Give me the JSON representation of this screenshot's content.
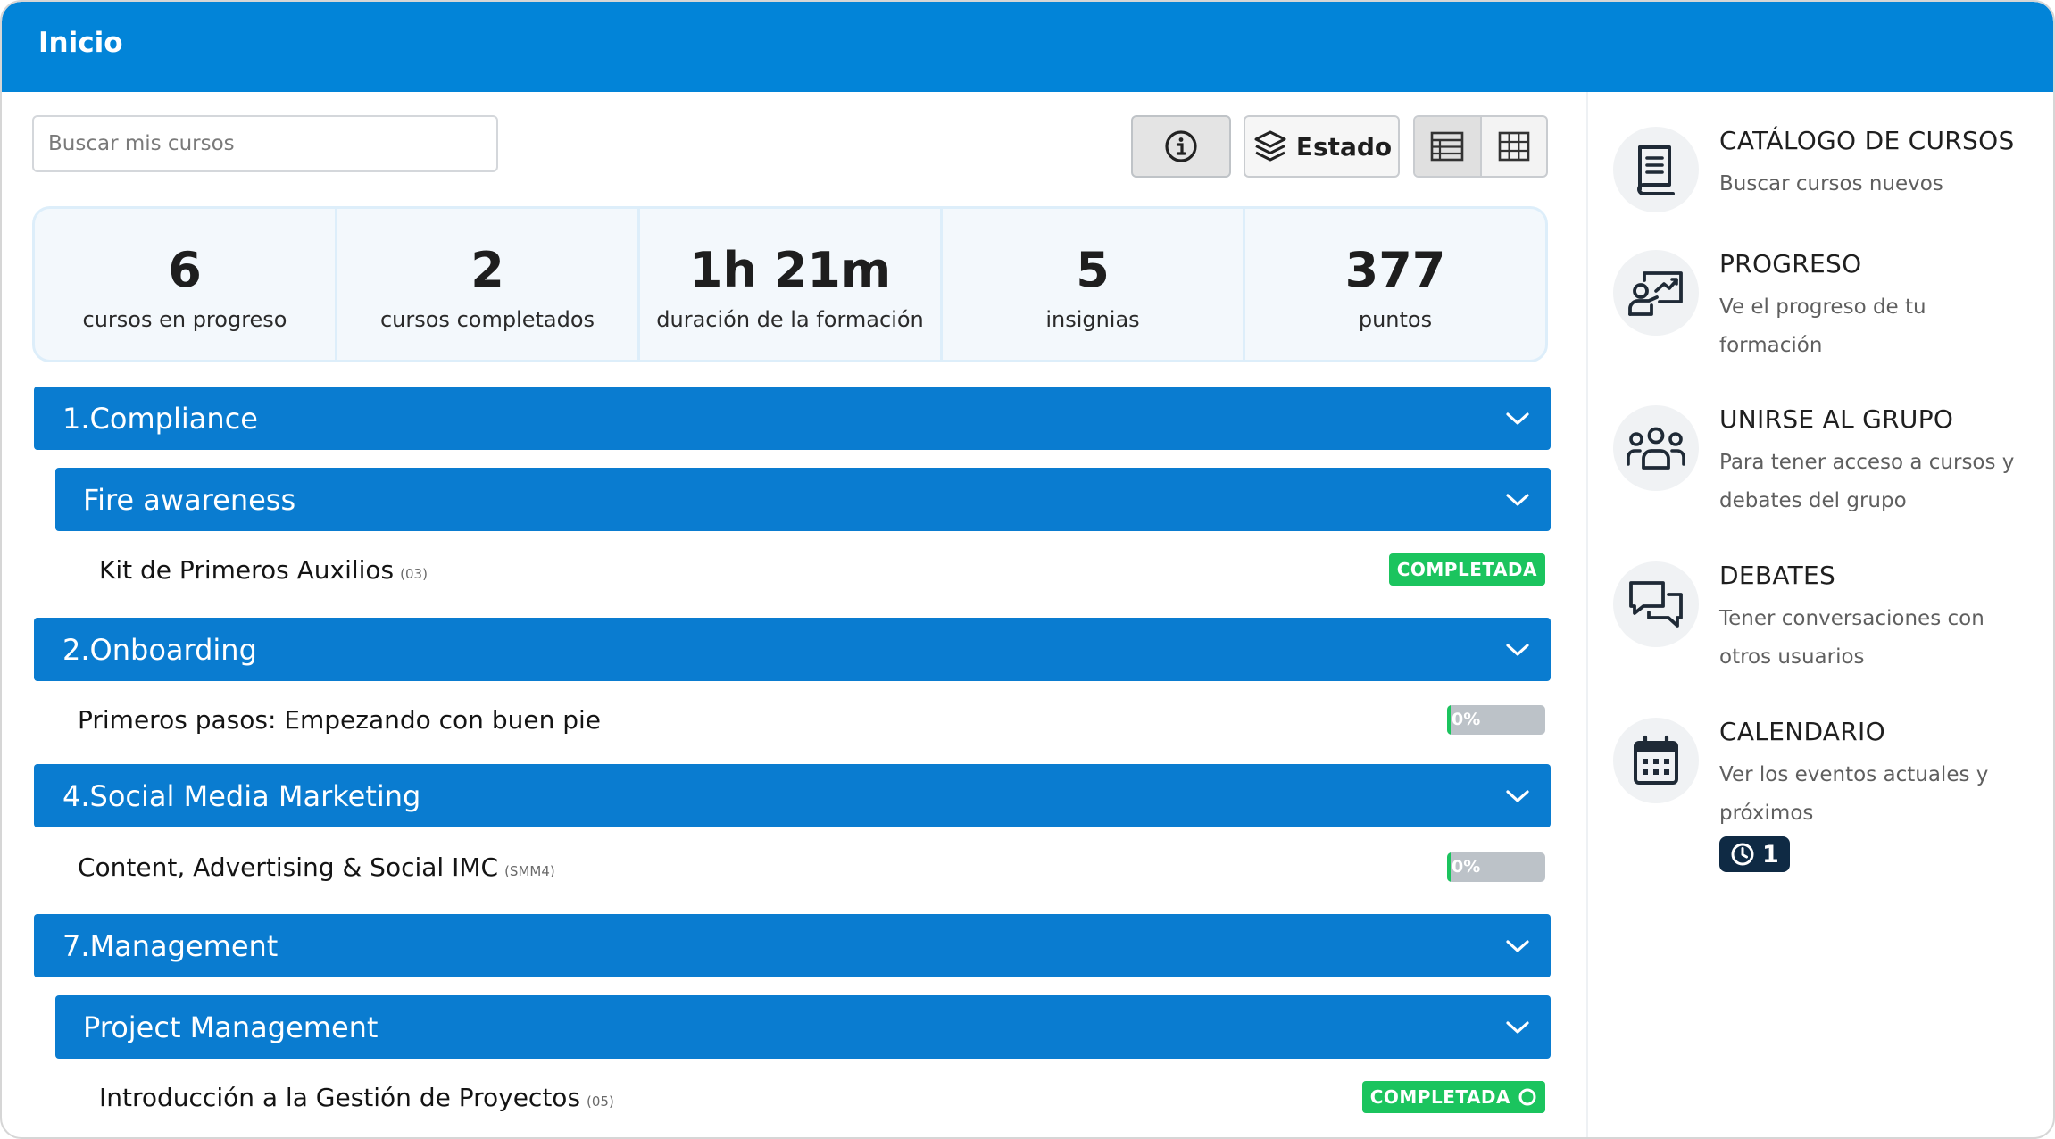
{
  "header": {
    "title": "Inicio"
  },
  "search": {
    "placeholder": "Buscar mis cursos"
  },
  "toolbar": {
    "estado_label": "Estado"
  },
  "stats": [
    {
      "value": "6",
      "label": "cursos en progreso"
    },
    {
      "value": "2",
      "label": "cursos completados"
    },
    {
      "value": "1h 21m",
      "label": "duración de la formación"
    },
    {
      "value": "5",
      "label": "insignias"
    },
    {
      "value": "377",
      "label": "puntos"
    }
  ],
  "courses": {
    "compliance": {
      "title": "1.Compliance",
      "fire": {
        "title": "Fire awareness",
        "item": {
          "title": "Kit de Primeros Auxilios",
          "code": "(03)",
          "status": "COMPLETADA"
        }
      }
    },
    "onboarding": {
      "title": "2.Onboarding",
      "item": {
        "title": "Primeros pasos: Empezando con buen pie",
        "progress_label": "0%",
        "progress": 0.04
      }
    },
    "social": {
      "title": "4.Social Media Marketing",
      "item": {
        "title": "Content, Advertising & Social IMC",
        "code": "(SMM4)",
        "progress_label": "0%",
        "progress": 0.04
      }
    },
    "management": {
      "title": "7.Management",
      "project": {
        "title": "Project Management",
        "item": {
          "title": "Introducción a la Gestión de Proyectos",
          "code": "(05)",
          "status": "COMPLETADA"
        }
      }
    }
  },
  "sidebar": {
    "catalog": {
      "title": "CATÁLOGO DE CURSOS",
      "desc": "Buscar cursos nuevos",
      "icon": "book-icon"
    },
    "progress": {
      "title": "PROGRESO",
      "desc": "Ve el progreso de tu formación",
      "icon": "progress-chart-icon"
    },
    "group": {
      "title": "UNIRSE AL GRUPO",
      "desc": "Para tener acceso a cursos y debates del grupo",
      "icon": "group-icon"
    },
    "debates": {
      "title": "DEBATES",
      "desc": "Tener conversaciones con otros usuarios",
      "icon": "chat-icon"
    },
    "calendar": {
      "title": "CALENDARIO",
      "desc": "Ver los eventos actuales y próximos",
      "icon": "calendar-icon",
      "badge_count": "1"
    }
  },
  "colors": {
    "primary": "#0a7cd0",
    "header": "#0284d8",
    "success": "#1bc45e",
    "dark_badge": "#0f2a44"
  }
}
